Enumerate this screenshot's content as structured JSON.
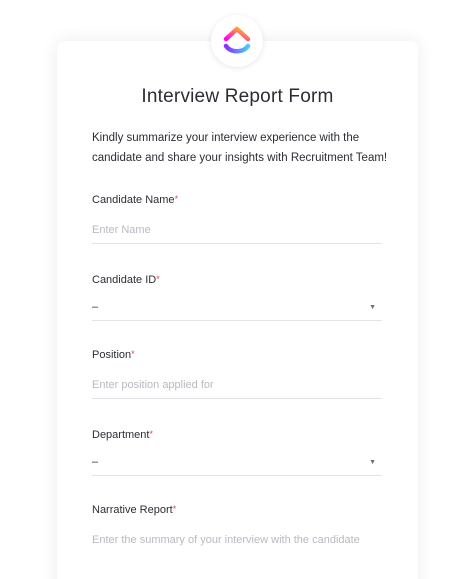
{
  "form": {
    "title": "Interview Report Form",
    "description": "Kindly summarize your interview experience with the candidate and share your insights with Recruitment Team!",
    "logo_icon": "clickup-logo-icon",
    "fields": {
      "candidate_name": {
        "label": "Candidate Name",
        "required_mark": "*",
        "placeholder": "Enter Name",
        "value": ""
      },
      "candidate_id": {
        "label": "Candidate ID",
        "required_mark": "*",
        "selected": "–",
        "arrow_icon": "dropdown-arrow-icon"
      },
      "position": {
        "label": "Position",
        "required_mark": "*",
        "placeholder": "Enter position applied for",
        "value": ""
      },
      "department": {
        "label": "Department",
        "required_mark": "*",
        "selected": "–",
        "arrow_icon": "dropdown-arrow-icon"
      },
      "narrative_report": {
        "label": "Narrative Report",
        "required_mark": "*",
        "placeholder": "Enter the summary of your interview with the candidate",
        "value": ""
      }
    }
  },
  "colors": {
    "required": "#e5484d",
    "text": "#2a2e34",
    "placeholder": "#b7bac1",
    "logo_gradient": [
      "#8930fd",
      "#49ccf9",
      "#ff02f0",
      "#ffc800"
    ]
  }
}
